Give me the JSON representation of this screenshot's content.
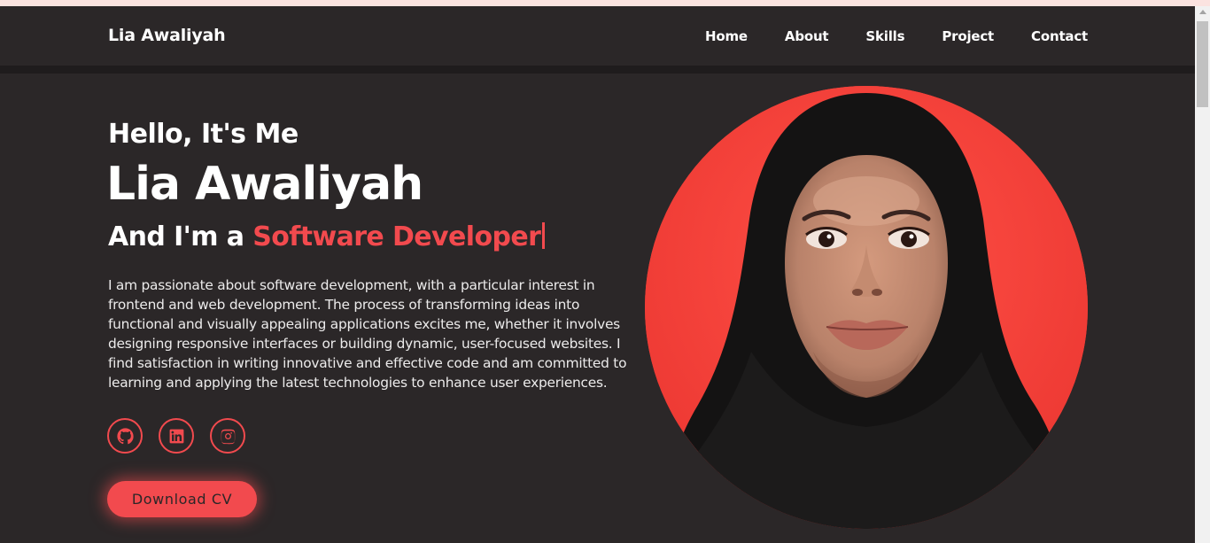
{
  "nav": {
    "brand": "Lia Awaliyah",
    "links": [
      "Home",
      "About",
      "Skills",
      "Project",
      "Contact"
    ]
  },
  "hero": {
    "greeting": "Hello, It's Me",
    "name": "Lia Awaliyah",
    "role_prefix": "And I'm a",
    "role_highlight": "Software Developer",
    "description": "I am passionate about software development, with a particular interest in frontend and web development. The process of transforming ideas into functional and visually appealing applications excites me, whether it involves designing responsive interfaces or building dynamic, user-focused websites. I find satisfaction in writing innovative and effective code and am committed to learning and applying the latest technologies to enhance user experiences.",
    "socials": [
      "github-icon",
      "linkedin-icon",
      "instagram-icon"
    ],
    "cv_button": "Download CV"
  },
  "colors": {
    "background": "#2b2728",
    "accent": "#f24a4e",
    "photo_bg": "#f63a34"
  }
}
